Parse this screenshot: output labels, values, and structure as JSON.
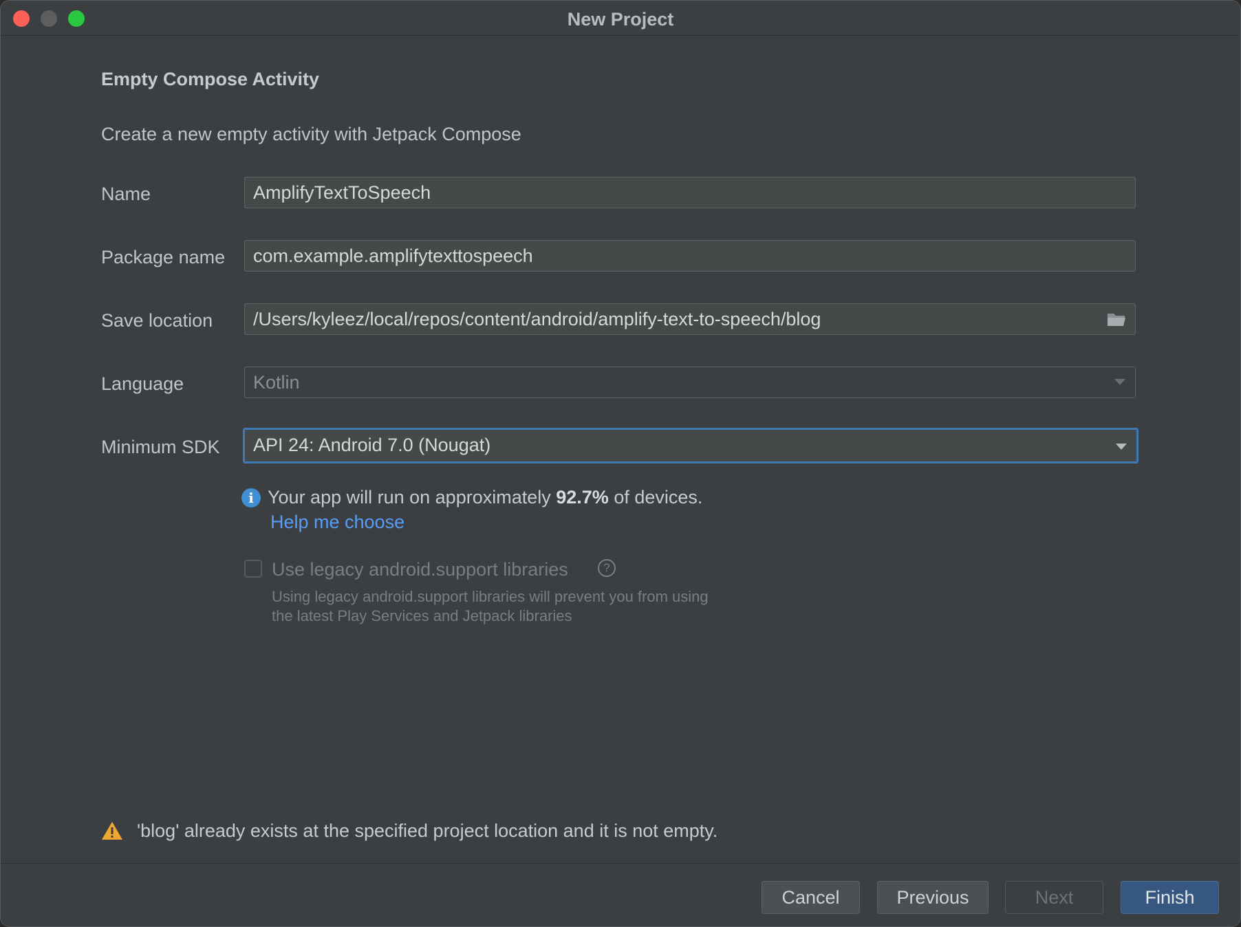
{
  "window": {
    "title": "New Project"
  },
  "template": {
    "heading": "Empty Compose Activity",
    "description": "Create a new empty activity with Jetpack Compose"
  },
  "form": {
    "name": {
      "label": "Name",
      "value": "AmplifyTextToSpeech"
    },
    "package": {
      "label": "Package name",
      "value": "com.example.amplifytexttospeech"
    },
    "save_location": {
      "label": "Save location",
      "value": "/Users/kyleez/local/repos/content/android/amplify-text-to-speech/blog",
      "icon": "folder-icon"
    },
    "language": {
      "label": "Language",
      "value": "Kotlin"
    },
    "min_sdk": {
      "label": "Minimum SDK",
      "value": "API 24: Android 7.0 (Nougat)"
    }
  },
  "info": {
    "prefix": "Your app will run on approximately ",
    "percent": "92.7%",
    "suffix": " of devices.",
    "help_link": "Help me choose"
  },
  "legacy": {
    "checked": false,
    "label": "Use legacy android.support libraries",
    "help_icon": "?",
    "note_line1": "Using legacy android.support libraries will prevent you from using",
    "note_line2": "the latest Play Services and Jetpack libraries"
  },
  "warning": {
    "text": "'blog' already exists at the specified project location and it is not empty."
  },
  "buttons": {
    "cancel": "Cancel",
    "previous": "Previous",
    "next": "Next",
    "finish": "Finish"
  },
  "colors": {
    "accent": "#3e7bb3",
    "link": "#589df6",
    "primary_button": "#365880",
    "warning": "#f0a732",
    "info": "#3f8fd2"
  }
}
